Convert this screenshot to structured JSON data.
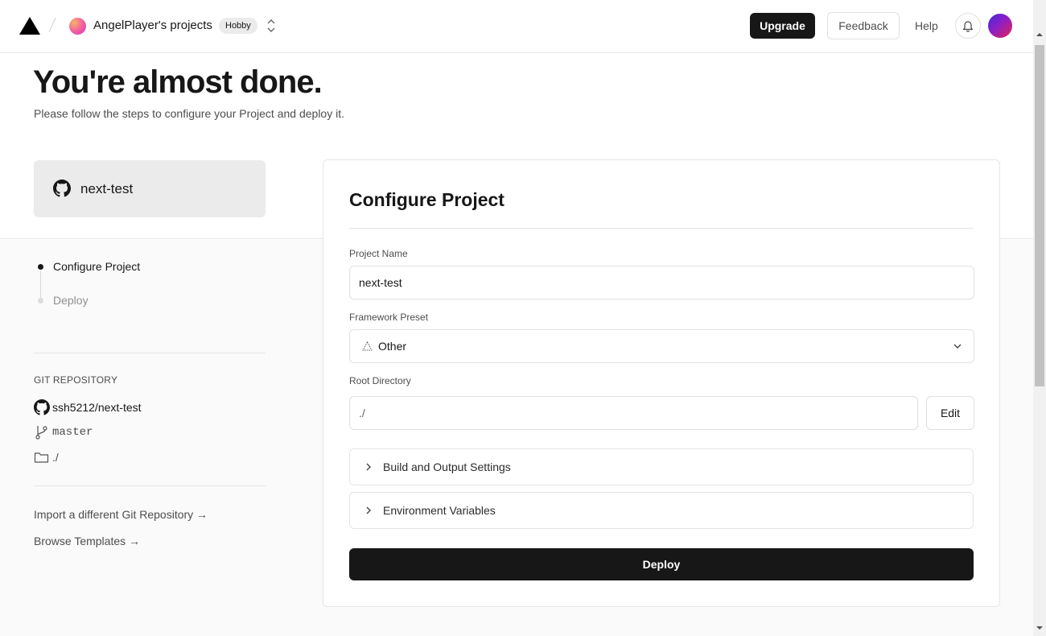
{
  "header": {
    "logo_icon": "triangle-logo-icon",
    "team_name": "AngelPlayer's projects",
    "plan_badge": "Hobby",
    "upgrade_label": "Upgrade",
    "feedback_label": "Feedback",
    "help_label": "Help",
    "notifications_icon": "bell-icon"
  },
  "page": {
    "title": "You're almost done.",
    "subtitle": "Please follow the steps to configure your Project and deploy it."
  },
  "repo_card": {
    "icon": "github-icon",
    "name": "next-test"
  },
  "steps": [
    {
      "label": "Configure Project",
      "active": true
    },
    {
      "label": "Deploy",
      "active": false
    }
  ],
  "git": {
    "heading": "GIT REPOSITORY",
    "repo": "ssh5212/next-test",
    "branch": "master",
    "directory": "./"
  },
  "links": {
    "import_repo": "Import a different Git Repository →",
    "browse_templates": "Browse Templates →"
  },
  "configure": {
    "title": "Configure Project",
    "project_name_label": "Project Name",
    "project_name_value": "next-test",
    "framework_label": "Framework Preset",
    "framework_value": "Other",
    "root_dir_label": "Root Directory",
    "root_dir_value": "./",
    "edit_label": "Edit",
    "build_settings_label": "Build and Output Settings",
    "env_vars_label": "Environment Variables",
    "deploy_label": "Deploy"
  },
  "colors": {
    "primary": "#171717",
    "muted_text": "#4d4d4d",
    "page_bg_lower": "#fafafa",
    "repo_card_bg": "#ebebeb"
  }
}
